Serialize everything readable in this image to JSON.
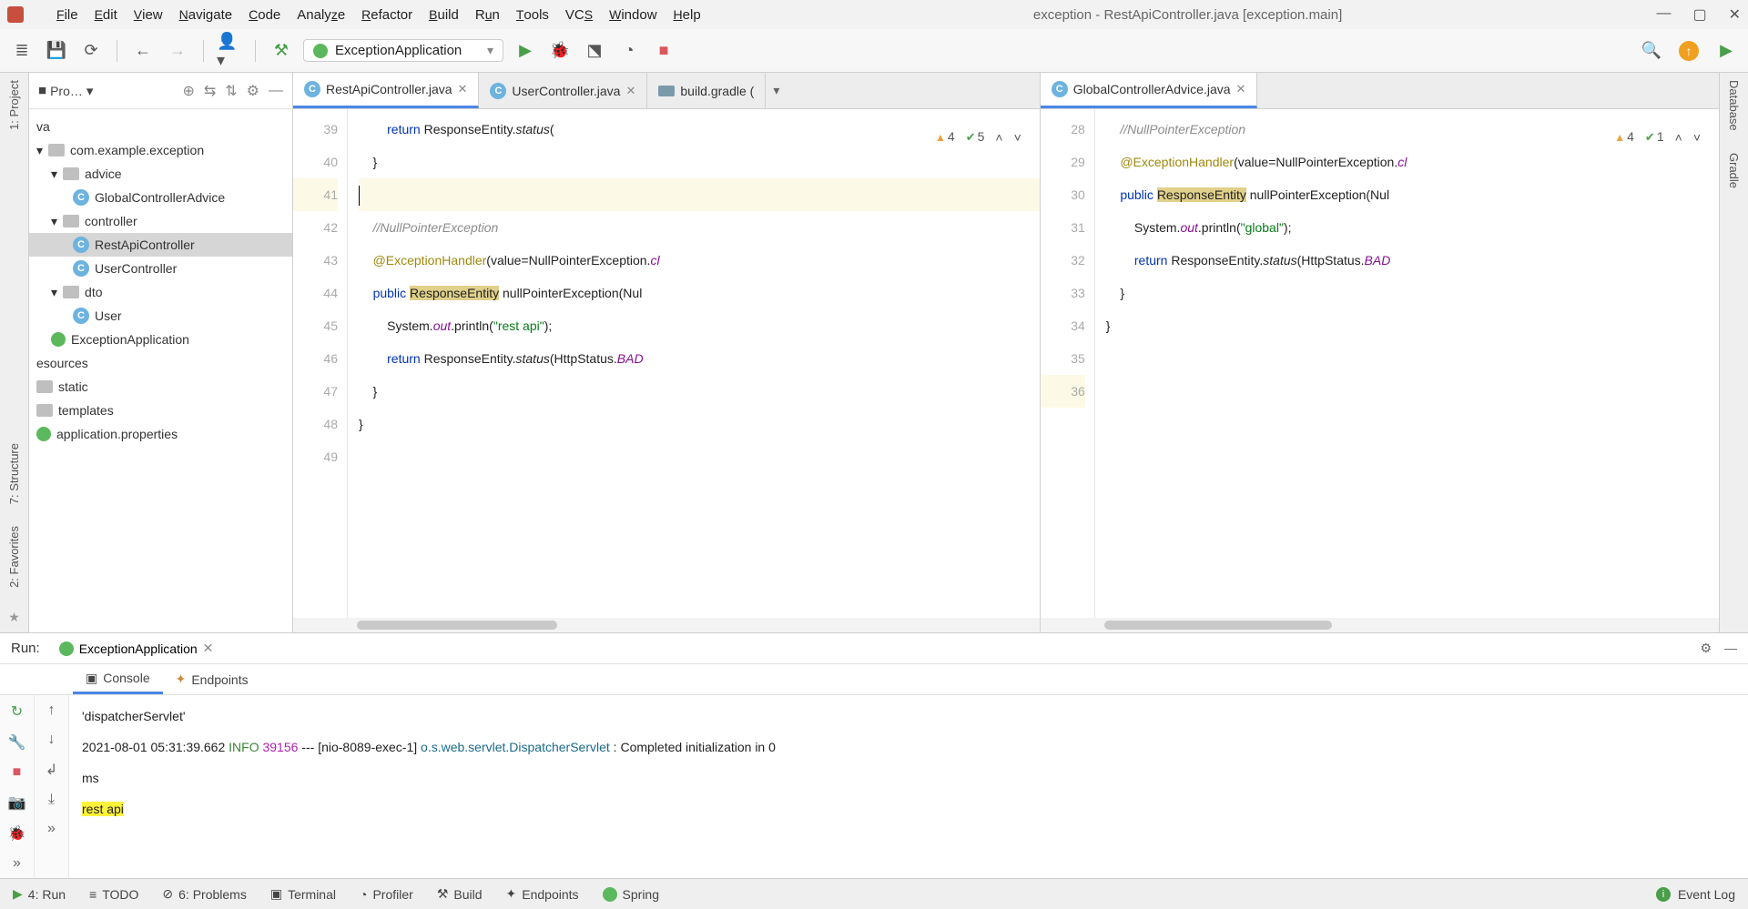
{
  "window": {
    "title": "exception - RestApiController.java [exception.main]"
  },
  "menu": [
    "File",
    "Edit",
    "View",
    "Navigate",
    "Code",
    "Analyze",
    "Refactor",
    "Build",
    "Run",
    "Tools",
    "VCS",
    "Window",
    "Help"
  ],
  "runConfig": {
    "label": "ExceptionApplication"
  },
  "leftRail": {
    "project": "1: Project",
    "structure": "7: Structure",
    "favorites": "2: Favorites"
  },
  "rightRail": {
    "database": "Database",
    "gradle": "Gradle"
  },
  "projectPanel": {
    "title": "Pro…",
    "tree": {
      "va": "va",
      "pkg": "com.example.exception",
      "advice": "advice",
      "globalControllerAdvice": "GlobalControllerAdvice",
      "controller": "controller",
      "restApiController": "RestApiController",
      "userController": "UserController",
      "dto": "dto",
      "user": "User",
      "exceptionApplication": "ExceptionApplication",
      "resources": "esources",
      "static": "static",
      "templates": "templates",
      "appProps": "application.properties"
    }
  },
  "tabs": {
    "rest": "RestApiController.java",
    "user": "UserController.java",
    "build": "build.gradle (",
    "global": "GlobalControllerAdvice.java"
  },
  "inspectLeft": {
    "warn": "4",
    "ok": "5"
  },
  "inspectRight": {
    "warn": "4",
    "ok": "1"
  },
  "leftEditor": {
    "lines": [
      "39",
      "40",
      "41",
      "42",
      "43",
      "44",
      "45",
      "46",
      "47",
      "48",
      "49"
    ],
    "c39a": "        ",
    "c39_ret": "return",
    "c39b": " ResponseEntity.",
    "c39_st": "status",
    "c39c": "(",
    "c40": "    }",
    "c41": "",
    "c42a": "    ",
    "c42_comment": "//NullPointerException",
    "c43a": "    ",
    "c43_ann": "@ExceptionHandler",
    "c43b": "(value=NullPointerException.",
    "c43_cl": "cl",
    "c44a": "    ",
    "c44_pub": "public",
    "c44b": " ",
    "c44_type": "ResponseEntity",
    "c44c": " nullPointerException(Nul",
    "c45a": "        System.",
    "c45_out": "out",
    "c45b": ".println(",
    "c45_str": "\"rest api\"",
    "c45c": ");",
    "c46a": "        ",
    "c46_ret": "return",
    "c46b": " ResponseEntity.",
    "c46_st": "status",
    "c46c": "(HttpStatus.",
    "c46_bad": "BAD",
    "c47": "    }",
    "c48": "}",
    "c49": ""
  },
  "rightEditor": {
    "lines": [
      "28",
      "29",
      "30",
      "31",
      "32",
      "33",
      "34",
      "35",
      "36"
    ],
    "c28": "",
    "c29a": "    ",
    "c29_comment": "//NullPointerException",
    "c30a": "    ",
    "c30_ann": "@ExceptionHandler",
    "c30b": "(value=NullPointerException.",
    "c30_cl": "cl",
    "c31a": "    ",
    "c31_pub": "public",
    "c31b": " ",
    "c31_type": "ResponseEntity",
    "c31c": " nullPointerException(Nul",
    "c32a": "        System.",
    "c32_out": "out",
    "c32b": ".println(",
    "c32_str": "\"global\"",
    "c32c": ");",
    "c33a": "        ",
    "c33_ret": "return",
    "c33b": " ResponseEntity.",
    "c33_st": "status",
    "c33c": "(HttpStatus.",
    "c33_bad": "BAD",
    "c34": "    }",
    "c35": "}",
    "c36": ""
  },
  "runPanel": {
    "label": "Run:",
    "tab": "ExceptionApplication",
    "consoleTab": "Console",
    "endpointsTab": "Endpoints",
    "line1": "  'dispatcherServlet'",
    "line2_ts": "2021-08-01 05:31:39.662  ",
    "line2_lvl": "INFO",
    "line2_sp": " ",
    "line2_pid": "39156",
    "line2_mid": " --- [nio-8089-exec-1] ",
    "line2_logger": "o.s.web.servlet.DispatcherServlet",
    "line2_end": "        : Completed initialization in 0",
    "line3": "  ms",
    "line4": "rest api "
  },
  "status": {
    "run": "4: Run",
    "todo": "TODO",
    "problems": "6: Problems",
    "terminal": "Terminal",
    "profiler": "Profiler",
    "build": "Build",
    "endpoints": "Endpoints",
    "spring": "Spring",
    "eventlog": "Event Log"
  }
}
